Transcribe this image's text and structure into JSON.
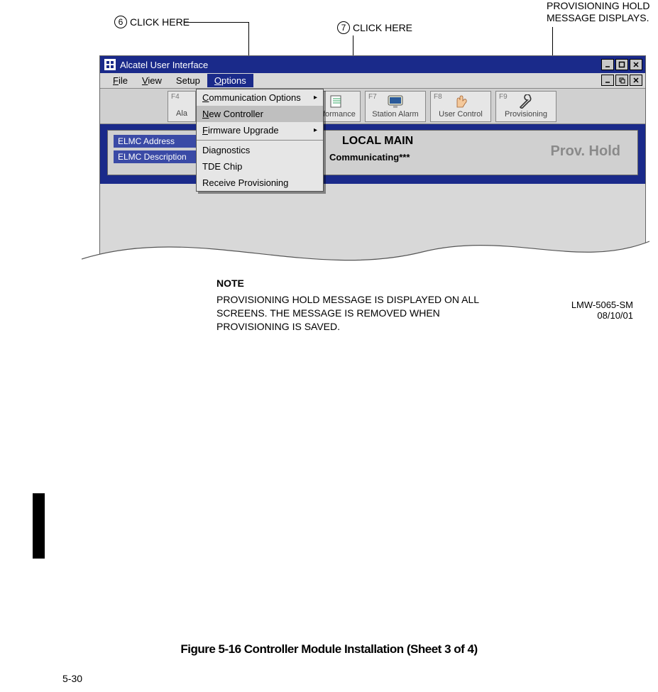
{
  "callouts": {
    "six": "CLICK HERE",
    "six_num": "6",
    "seven": "CLICK HERE",
    "seven_num": "7",
    "prov_hold_top": "PROVISIONING HOLD",
    "prov_hold_bot": "MESSAGE DISPLAYS."
  },
  "window": {
    "title": "Alcatel User Interface"
  },
  "menus": {
    "file": "File",
    "view": "View",
    "setup": "Setup",
    "options": "Options"
  },
  "dropdown": {
    "comm_opts": "Communication Options",
    "new_ctrl": "New Controller",
    "fw_upgrade": "Firmware Upgrade",
    "diagnostics": "Diagnostics",
    "tde_chip": "TDE Chip",
    "recv_prov": "Receive Provisioning"
  },
  "toolbar": {
    "f4_key": "F4",
    "f4_label": "Ala",
    "f6_key": "",
    "f6_label": "erformance",
    "f7_key": "F7",
    "f7_label": "Station Alarm",
    "f8_key": "F8",
    "f8_label": "User Control",
    "f9_key": "F9",
    "f9_label": "Provisioning"
  },
  "status": {
    "elmc_addr": "ELMC Address",
    "elmc_desc": "ELMC Description",
    "heading": "LOCAL MAIN",
    "communicating": "Communicating***",
    "prov_hold": "Prov. Hold"
  },
  "note": {
    "hdr": "NOTE",
    "body": "PROVISIONING HOLD MESSAGE IS DISPLAYED ON ALL SCREENS. THE MESSAGE IS REMOVED WHEN PROVISIONING IS SAVED."
  },
  "doc_id": {
    "line1": "LMW-5065-SM",
    "line2": "08/10/01"
  },
  "figure_caption": "Figure 5-16  Controller Module Installation (Sheet 3 of 4)",
  "page_number": "5-30"
}
